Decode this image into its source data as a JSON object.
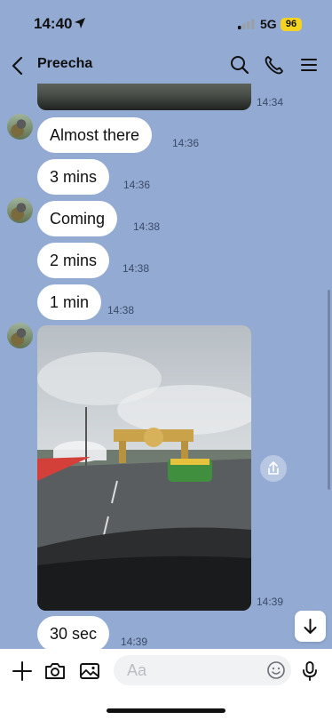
{
  "status_bar": {
    "time": "14:40",
    "network": "5G",
    "battery": "96"
  },
  "header": {
    "contact_name": "Preecha"
  },
  "messages": [
    {
      "text": "Almost there",
      "time": "14:36"
    },
    {
      "text": "3 mins",
      "time": "14:36"
    },
    {
      "text": "Coming",
      "time": "14:38"
    },
    {
      "text": "2 mins",
      "time": "14:38"
    },
    {
      "text": "1 min",
      "time": "14:38"
    },
    {
      "text": "30 sec",
      "time": "14:39"
    }
  ],
  "media": {
    "top_image_time": "14:34",
    "video_time": "14:39"
  },
  "composer": {
    "placeholder": "Aa"
  },
  "colors": {
    "chat_background": "#93aad3",
    "bubble": "#ffffff",
    "battery_badge": "#f5d421"
  },
  "icons": [
    "location-arrow-icon",
    "signal-icon",
    "back-chevron-icon",
    "search-icon",
    "phone-icon",
    "menu-icon",
    "share-icon",
    "arrow-down-icon",
    "plus-icon",
    "camera-icon",
    "image-icon",
    "emoji-icon",
    "microphone-icon"
  ]
}
